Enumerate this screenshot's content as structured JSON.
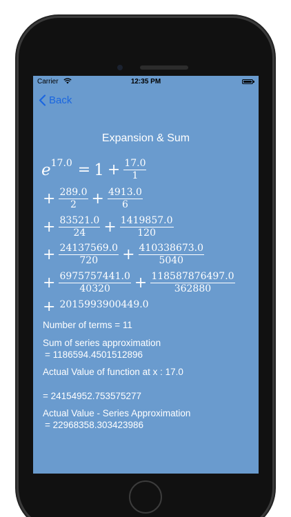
{
  "status_bar": {
    "carrier": "Carrier",
    "time": "12:35 PM"
  },
  "nav": {
    "back_label": "Back"
  },
  "title": "Expansion & Sum",
  "expansion": {
    "base": "e",
    "exponent": "17.0",
    "equals": "=",
    "first_term": "1",
    "plus": "+",
    "terms": [
      {
        "num": "17.0",
        "den": "1"
      },
      {
        "num": "289.0",
        "den": "2"
      },
      {
        "num": "4913.0",
        "den": "6"
      },
      {
        "num": "83521.0",
        "den": "24"
      },
      {
        "num": "1419857.0",
        "den": "120"
      },
      {
        "num": "24137569.0",
        "den": "720"
      },
      {
        "num": "410338673.0",
        "den": "5040"
      },
      {
        "num": "6975757441.0",
        "den": "40320"
      },
      {
        "num": "118587876497.0",
        "den": "362880"
      },
      {
        "num": "2015993900449.0",
        "den": ""
      }
    ]
  },
  "info": {
    "terms_line": "Number of terms = 11",
    "sum_label": "Sum of series approximation",
    "sum_value": "= 1186594.4501512896",
    "actual_label": "Actual Value of function at x : 17.0",
    "actual_value": "= 24154952.753575277",
    "diff_label": "Actual Value - Series Approximation",
    "diff_value": "= 22968358.303423986"
  }
}
